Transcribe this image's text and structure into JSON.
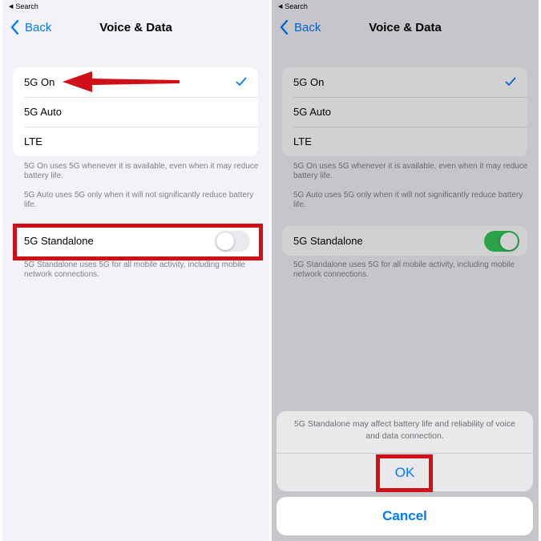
{
  "status_bar": {
    "back_app": "Search"
  },
  "nav": {
    "back_label": "Back",
    "title": "Voice & Data"
  },
  "options": [
    {
      "label": "5G On",
      "selected": true
    },
    {
      "label": "5G Auto",
      "selected": false
    },
    {
      "label": "LTE",
      "selected": false
    }
  ],
  "footnotes": {
    "on": "5G On uses 5G whenever it is available, even when it may reduce battery life.",
    "auto": "5G Auto uses 5G only when it will not significantly reduce battery life.",
    "standalone": "5G Standalone uses 5G for all mobile activity, including mobile network connections."
  },
  "standalone": {
    "label": "5G Standalone",
    "left_state": "off",
    "right_state": "on"
  },
  "alert": {
    "message": "5G Standalone may affect battery life and reliability of voice and data connection.",
    "ok_label": "OK",
    "cancel_label": "Cancel"
  },
  "colors": {
    "accent": "#007aff",
    "switch_on": "#34c759",
    "annotation_red": "#d00f18",
    "background": "#f2f2f7"
  },
  "icons": [
    "back-chevron-icon",
    "checkmark-icon",
    "red-arrow-annotation"
  ]
}
